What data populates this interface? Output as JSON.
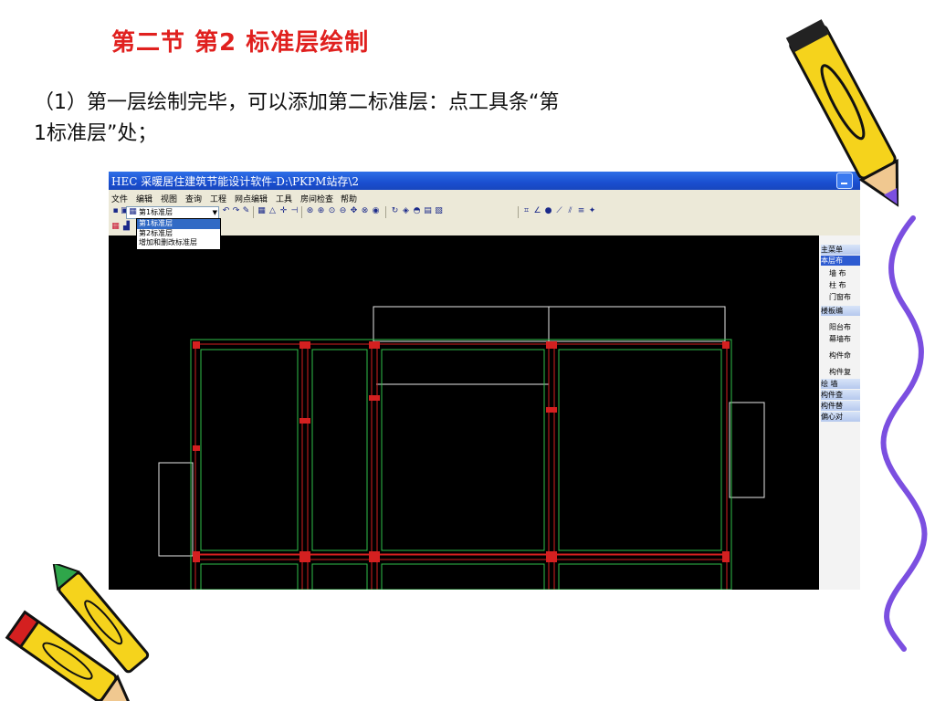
{
  "slide": {
    "title": "第二节 第2 标准层绘制",
    "line1": "（1）第一层绘制完毕，可以添加第二标准层：点工具条“第",
    "line2": "1标准层”处；"
  },
  "app": {
    "window_title": "HEC 采暖居住建筑节能设计软件-D:\\PKPM站存\\2",
    "menu": [
      "文件",
      "编辑",
      "视图",
      "查询",
      "工程",
      "网点编辑",
      "工具",
      "房间检查",
      "帮助"
    ],
    "floor_select": {
      "value": "第1标准层",
      "options": [
        "第1标准层",
        "第2标准层",
        "增加和删改标准层"
      ]
    },
    "sidebar": [
      {
        "label": "主菜单",
        "kind": "head"
      },
      {
        "label": "本层布",
        "kind": "active"
      },
      {
        "label": "墙 布",
        "kind": "sub"
      },
      {
        "label": "柱 布",
        "kind": "sub"
      },
      {
        "label": "门窗布",
        "kind": "sub"
      },
      {
        "label": "楼板编",
        "kind": "head"
      },
      {
        "label": "阳台布",
        "kind": "sub"
      },
      {
        "label": "幕墙布",
        "kind": "sub"
      },
      {
        "label": "构件命",
        "kind": "sub"
      },
      {
        "label": "构件复",
        "kind": "icon"
      },
      {
        "label": "绘 墙",
        "kind": "head"
      },
      {
        "label": "构件查",
        "kind": "head"
      },
      {
        "label": "构件替",
        "kind": "head"
      },
      {
        "label": "偏心对",
        "kind": "head"
      }
    ]
  },
  "colors": {
    "title_red": "#e0201e",
    "canvas": "#000000",
    "wall_green": "#2fbf4a",
    "axis_red": "#d42020",
    "outline_white": "#e8e8e8",
    "pencil_yellow": "#f5d31c",
    "squiggle_purple": "#7b4fe0"
  }
}
